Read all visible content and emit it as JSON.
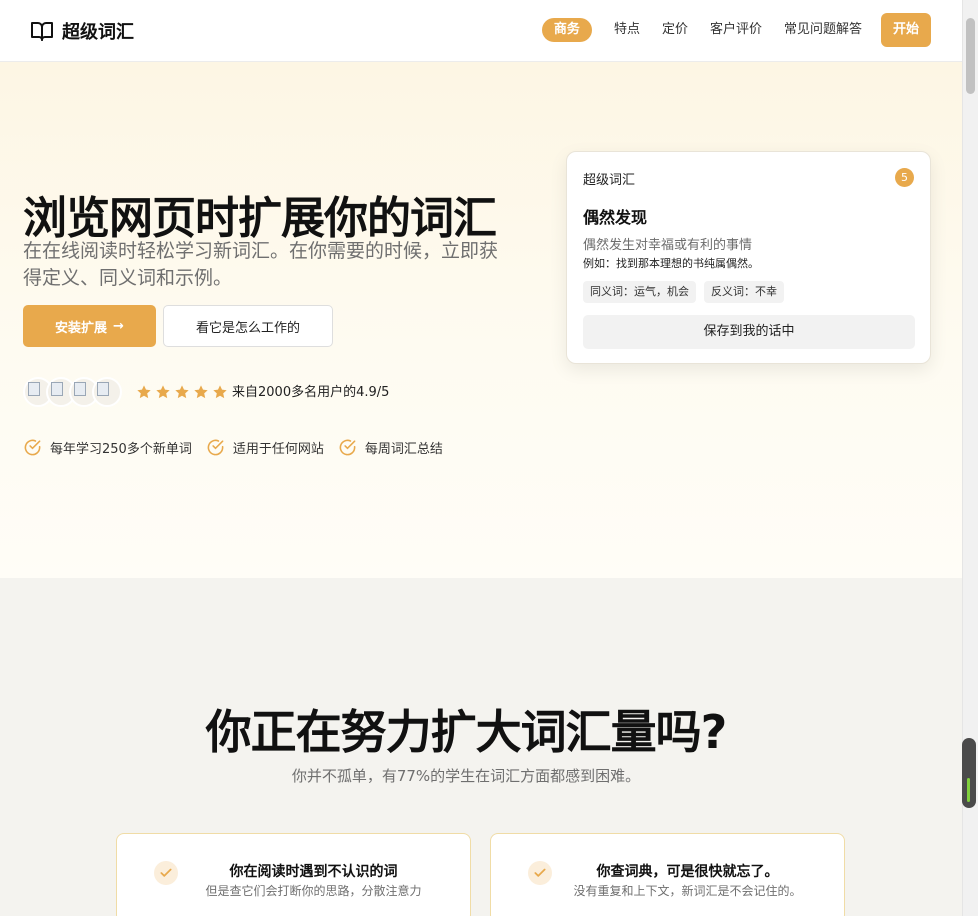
{
  "header": {
    "logo_text": "超级词汇",
    "nav": [
      {
        "label": "商务"
      },
      {
        "label": "特点"
      },
      {
        "label": "定价"
      },
      {
        "label": "客户评价"
      },
      {
        "label": "常见问题解答"
      }
    ],
    "start_label": "开始"
  },
  "hero": {
    "title": "浏览网页时扩展你的词汇",
    "subtitle": "在在线阅读时轻松学习新词汇。在你需要的时候，立即获得定义、同义词和示例。",
    "install_label": "安装扩展",
    "install_arrow": "→",
    "how_label": "看它是怎么工作的",
    "stars": 5,
    "rating_text": "来自2000多名用户的4.9/5",
    "features": [
      "每年学习250多个新单词",
      "适用于任何网站",
      "每周词汇总结"
    ]
  },
  "card": {
    "app_name": "超级词汇",
    "badge": "5",
    "word": "偶然发现",
    "definition": "偶然发生对幸福或有利的事情",
    "example": "例如：找到那本理想的书纯属偶然。",
    "synonyms": "同义词：运气，机会",
    "antonyms": "反义词：不幸",
    "save_label": "保存到我的话中"
  },
  "problem": {
    "title": "你正在努力扩大词汇量吗?",
    "subtitle": "你并不孤单，有77%的学生在词汇方面都感到困难。",
    "cards": [
      {
        "title": "你在阅读时遇到不认识的词",
        "desc": "但是查它们会打断你的思路，分散注意力"
      },
      {
        "title": "你查词典，可是很快就忘了。",
        "desc": "没有重复和上下文，新词汇是不会记住的。"
      }
    ]
  },
  "colors": {
    "accent": "#e8a94c",
    "hero_bg": "#fdf6e4",
    "section_bg": "#f4f3ef"
  }
}
